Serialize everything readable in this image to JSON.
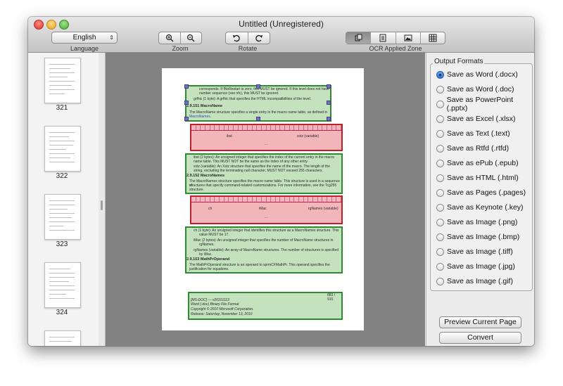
{
  "window": {
    "title": "Untitled (Unregistered)"
  },
  "toolbar": {
    "language": {
      "value": "English",
      "label": "Language"
    },
    "zoom": {
      "label": "Zoom",
      "in_icon": "zoom-in-icon",
      "out_icon": "zoom-out-icon"
    },
    "rotate": {
      "label": "Rotate",
      "left_icon": "rotate-left-icon",
      "right_icon": "rotate-right-icon"
    },
    "ocr_zone": {
      "label": "OCR Applied Zone",
      "active_index": 0
    }
  },
  "thumbnails": [
    {
      "label": "321"
    },
    {
      "label": "322"
    },
    {
      "label": "323"
    },
    {
      "label": "324"
    }
  ],
  "document": {
    "z1": {
      "l1": "corresponds. If fNoRestart is zero, this MUST be ignored. If this level does not have",
      "l2": "number sequence (see nfc), this MUST be ignored.",
      "l3": "grfhic (1 byte): A grfhic that specifies the HTML incompatibilities of the level.",
      "h": "2.9.151   MacroName",
      "l4": "The MacroName structure specifies a single entry in the macro name table, as defined in",
      "l5": "MacroNames."
    },
    "r1": {
      "c1": "ibst",
      "c2": "xstz (variable)",
      "c3": "..."
    },
    "z2": {
      "l1": "ibst (2 bytes): An unsigned integer that specifies the index of the current entry in the macro",
      "l2": "name table. This MUST NOT be the same as the index of any other entry.",
      "l3": "xstz (variable): An Xstz structure that specifies the name of the macro. The length of the",
      "l4": "string, excluding the terminating null character, MUST NOT exceed 255 characters.",
      "h": "2.9.152   MacroNames",
      "l5": "The MacroNames structure specifies the macro name table. This structure is used in a sequence of",
      "l6": "structures that specify command-related customizations. For more information, see the Tcg255",
      "l7": "structure."
    },
    "r2": {
      "c1": "ch",
      "c2": "iMac",
      "c3": "rgNames (variable)",
      "c4": "..."
    },
    "z3": {
      "l1": "ch (1 byte): An unsigned integer that identifies this structure as a MacroNames structure. This",
      "l2": "value MUST be 17.",
      "l3": "iMac (2 bytes): An unsigned integer that specifies the number of MacroName structures in",
      "l4": "rgNames.",
      "l5": "rgNames (variable): An array of MacroName structures. The number of structures is specified",
      "l6": "by iMac.",
      "h": "2.9.153   MathPrOperand",
      "l7": "The MathPrOperand structure is an operand to sprmCFMathPr. This operand specifies the",
      "l8": "justification for equations."
    },
    "z4": {
      "a": "883 / 910",
      "l1": "[MS-DOC] — v20101113",
      "l2": "Word (.doc) Binary File Format",
      "l3": "Copyright © 2010 Microsoft Corporation.",
      "l4": "Release: Saturday, November 13, 2010"
    }
  },
  "output_formats": {
    "legend": "Output Formats",
    "selected_index": 0,
    "options": [
      "Save as Word (.docx)",
      "Save as Word (.doc)",
      "Save as PowerPoint (.pptx)",
      "Save as Excel (.xlsx)",
      "Save as Text (.text)",
      "Save as Rtfd (.rtfd)",
      "Save as ePub (.epub)",
      "Save as HTML (.html)",
      "Save as Pages (.pages)",
      "Save as Keynote (.key)",
      "Save as Image (.png)",
      "Save as Image (.bmp)",
      "Save as Image (.tiff)",
      "Save as Image (.jpg)",
      "Save as Image (.gif)"
    ]
  },
  "actions": {
    "preview": "Preview Current Page",
    "convert": "Convert"
  }
}
